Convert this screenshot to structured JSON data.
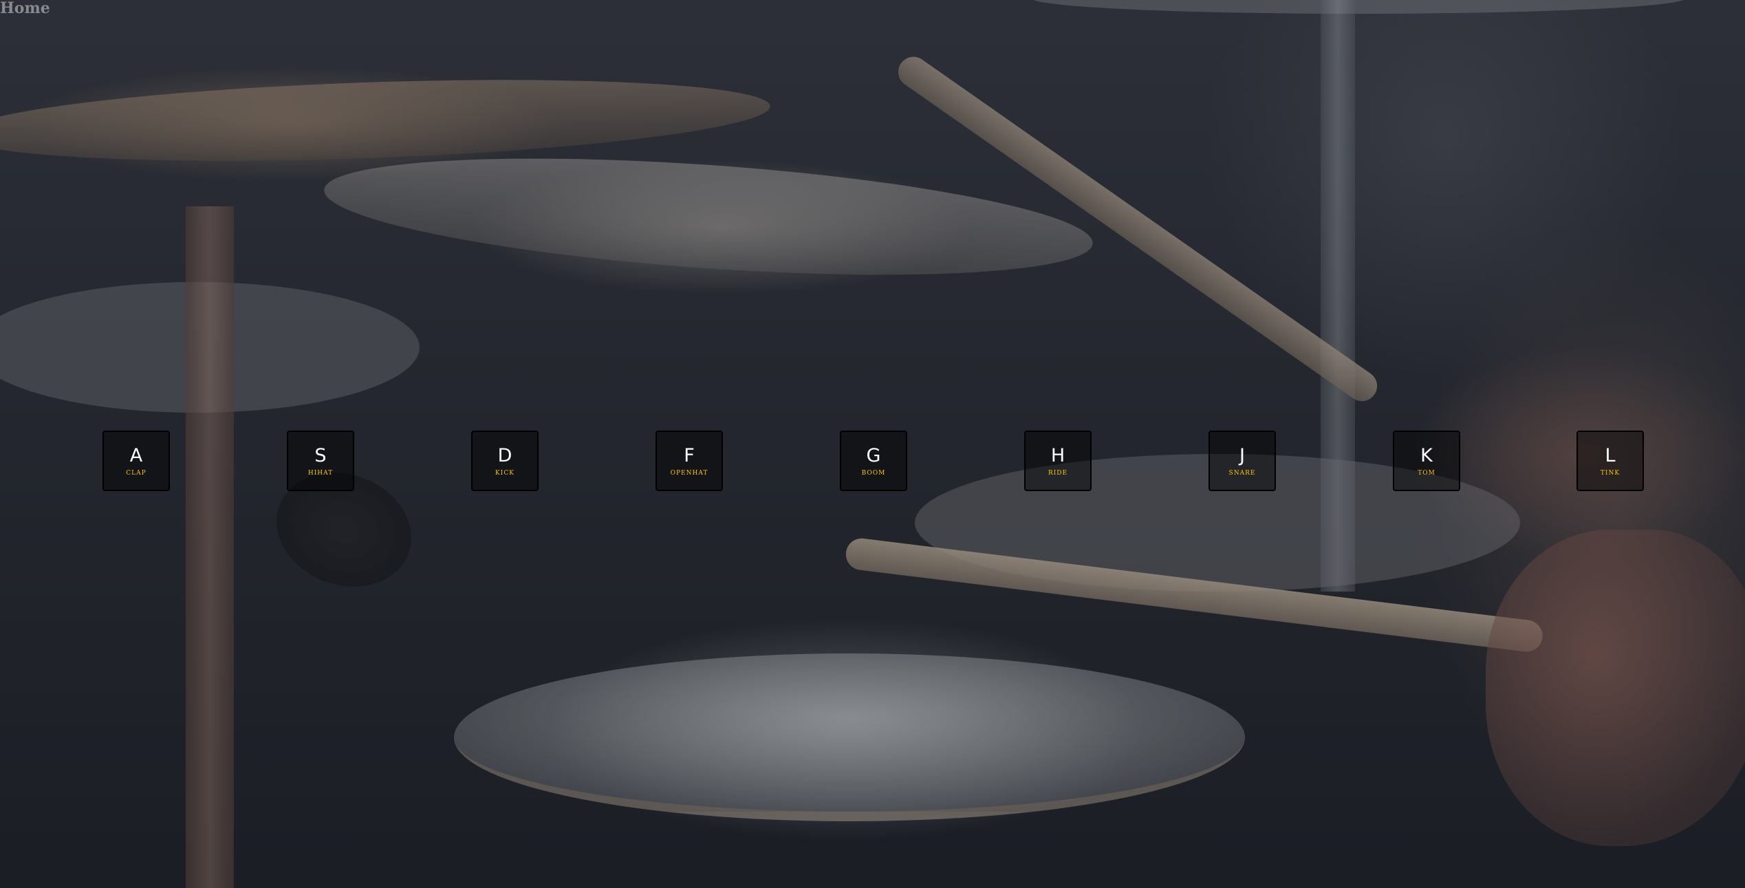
{
  "nav": {
    "home_label": "Home"
  },
  "background": {
    "subject": "drum kit photograph"
  },
  "accent_color": "#ffc600",
  "keys": [
    {
      "letter": "A",
      "sound": "clap"
    },
    {
      "letter": "S",
      "sound": "hihat"
    },
    {
      "letter": "D",
      "sound": "kick"
    },
    {
      "letter": "F",
      "sound": "openhat"
    },
    {
      "letter": "G",
      "sound": "boom"
    },
    {
      "letter": "H",
      "sound": "ride"
    },
    {
      "letter": "J",
      "sound": "snare"
    },
    {
      "letter": "K",
      "sound": "tom"
    },
    {
      "letter": "L",
      "sound": "tink"
    }
  ]
}
